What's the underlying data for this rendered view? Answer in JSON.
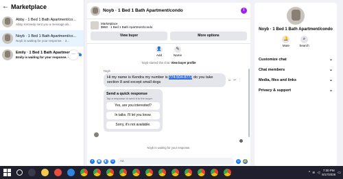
{
  "left": {
    "title": "Marketplace",
    "conversations": [
      {
        "name": "Abby · 1 Bed 1 Bath Apartment/co...",
        "snippet": "Abby Kennedy sent you a message ab...",
        "active": false,
        "unread": false
      },
      {
        "name": "Noyb · 1 Bed 1 Bath Apartment/co...",
        "snippet": "Noyb is waiting for your response. · 3...",
        "active": true,
        "unread": false
      },
      {
        "name": "Emily · 1 Bed 1 Bath Apartment/co...",
        "snippet": "Emily is waiting for your response. · ...",
        "active": false,
        "unread": true
      }
    ],
    "more_label": "···"
  },
  "mid": {
    "title": "Noyb · 1 Bed 1 Bath Apartment/condo",
    "info_label": "i",
    "listing_label": "Marketplace",
    "listing_price": "$950 · 1 Bed 1 Bath Apartment/condo",
    "view_buyer": "View buyer",
    "more_options": "More options",
    "add_label": "Add",
    "name_label": "Name",
    "system_prefix": "Noyb started this chat.",
    "system_link": "View buyer profile",
    "sender": "Noyb",
    "msg_pre": "Hi my name is Kendra my number is",
    "msg_phone": "774-504-8772",
    "msg_post": "do you take section 8 and except small dogs",
    "quick_title": "Send a quick response",
    "quick_sub": "Tap a response to send it to the buyer.",
    "quick_options": [
      "Yes, are you interested?",
      "In talks. I'll let you know.",
      "Sorry, it's not available."
    ],
    "waiting": "Noyb is waiting for your response.",
    "composer_placeholder": "Aa"
  },
  "right": {
    "name": "Noyb · 1 Bed 1 Bath Apartment/condo",
    "mute": "Mute",
    "search": "Search",
    "sections": [
      "Customize chat",
      "Chat members",
      "Media, files and links",
      "Privacy & support"
    ]
  },
  "taskbar": {
    "time": "7:30 PM",
    "date": "5/17/2026"
  }
}
